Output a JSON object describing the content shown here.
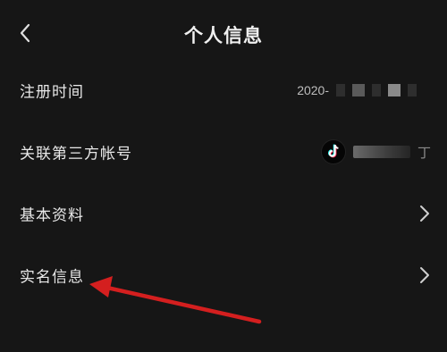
{
  "header": {
    "title": "个人信息"
  },
  "rows": [
    {
      "label": "注册时间",
      "value": "2020-"
    },
    {
      "label": "关联第三方帐号",
      "value_suffix": "丁"
    },
    {
      "label": "基本资料"
    },
    {
      "label": "实名信息"
    }
  ],
  "colors": {
    "background": "#161616",
    "text": "#e6e6e6",
    "annotation_arrow": "#d41f1f"
  },
  "icons": {
    "back": "chevron-left-icon",
    "tiktok": "tiktok-logo-icon",
    "forward": "chevron-right-icon"
  }
}
